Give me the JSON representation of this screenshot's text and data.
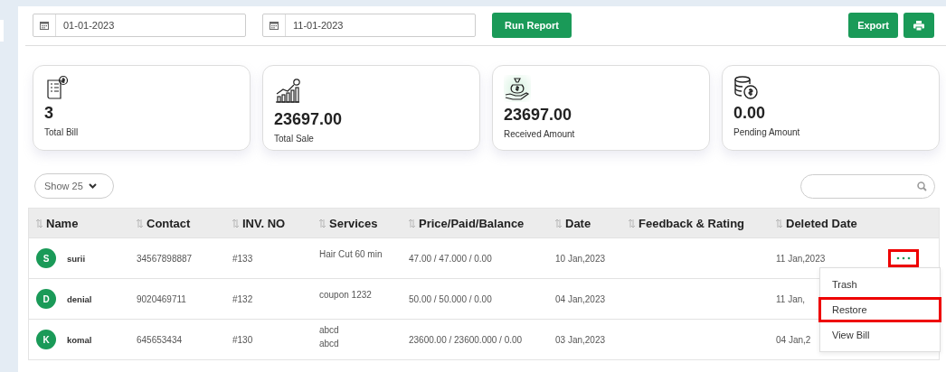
{
  "filters": {
    "start_date": "01-01-2023",
    "end_date": "11-01-2023",
    "run_button": "Run Report"
  },
  "actions": {
    "export": "Export"
  },
  "stats": [
    {
      "kind": "bill",
      "value": "3",
      "label": "Total Bill"
    },
    {
      "kind": "sale",
      "value": "23697.00",
      "label": "Total Sale"
    },
    {
      "kind": "received",
      "value": "23697.00",
      "label": "Received Amount"
    },
    {
      "kind": "pending",
      "value": "0.00",
      "label": "Pending Amount"
    }
  ],
  "page_size": "Show 25",
  "table": {
    "columns": [
      "Name",
      "Contact",
      "INV. NO",
      "Services",
      "Price/Paid/Balance",
      "Date",
      "Feedback & Rating",
      "Deleted Date"
    ],
    "rows": [
      {
        "initial": "S",
        "name": "surii",
        "contact": "34567898887",
        "invoice": "#133",
        "services": [
          "Hair Cut 60 min"
        ],
        "amounts": "47.00 / 47.000 / 0.00",
        "date": "10 Jan,2023",
        "deleted_date": "11 Jan,2023",
        "menu_open": true
      },
      {
        "initial": "D",
        "name": "denial",
        "contact": "9020469711",
        "invoice": "#132",
        "services": [
          "coupon 1232"
        ],
        "amounts": "50.00 / 50.000 / 0.00",
        "date": "04 Jan,2023",
        "deleted_date": "11 Jan,",
        "menu_open": false
      },
      {
        "initial": "K",
        "name": "komal",
        "contact": "645653434",
        "invoice": "#130",
        "services": [
          "abcd",
          "abcd"
        ],
        "amounts": "23600.00 / 23600.000 / 0.00",
        "date": "03 Jan,2023",
        "deleted_date": "04 Jan,2",
        "menu_open": false
      }
    ]
  },
  "menu_button_highlighted": true,
  "row_menu": [
    {
      "label": "Trash",
      "highlighted": false
    },
    {
      "label": "Restore",
      "highlighted": true
    },
    {
      "label": "View Bill",
      "highlighted": false
    }
  ]
}
